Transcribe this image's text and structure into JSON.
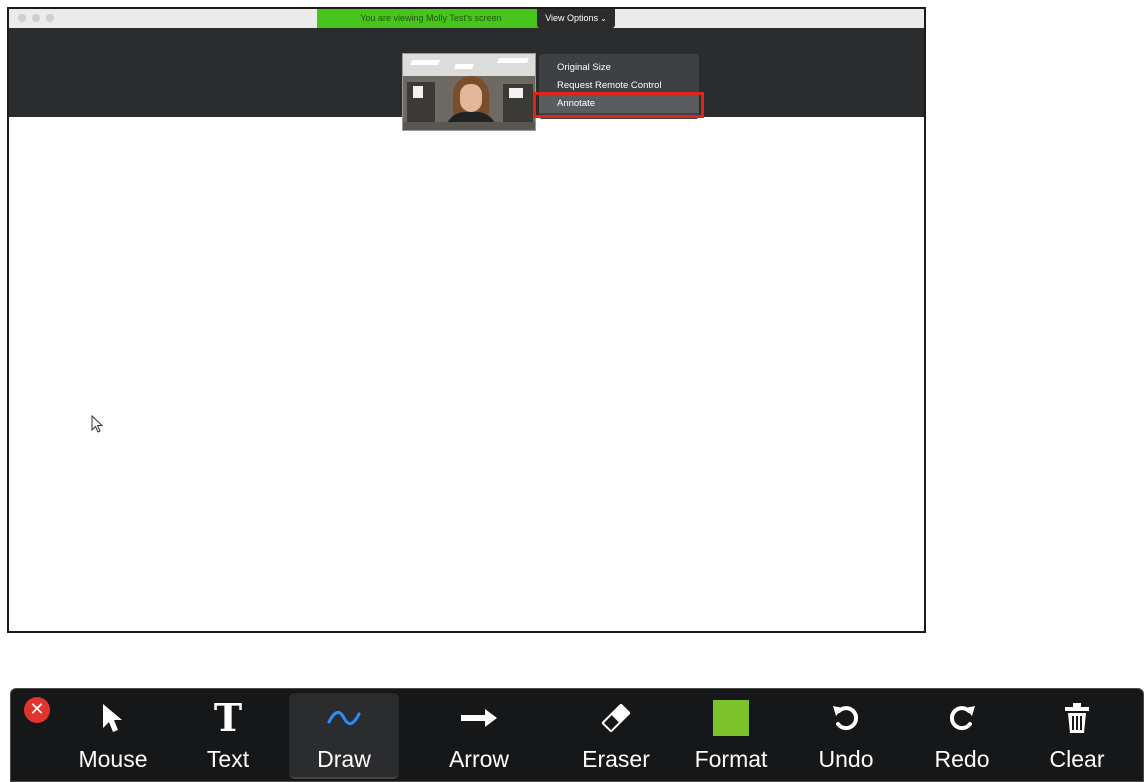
{
  "window": {
    "banner_text": "You are viewing Molly Test's screen",
    "view_options_label": "View Options",
    "menu": {
      "items": [
        "Original Size",
        "Request Remote Control",
        "Annotate"
      ],
      "highlighted_index": 2
    }
  },
  "toolbar": {
    "tools": [
      {
        "label": "Mouse",
        "icon": "cursor-arrow-icon"
      },
      {
        "label": "Text",
        "icon": "text-icon"
      },
      {
        "label": "Draw",
        "icon": "squiggle-icon"
      },
      {
        "label": "Arrow",
        "icon": "right-arrow-icon"
      },
      {
        "label": "Eraser",
        "icon": "eraser-icon"
      },
      {
        "label": "Format",
        "icon": "color-swatch-icon"
      },
      {
        "label": "Undo",
        "icon": "undo-icon"
      },
      {
        "label": "Redo",
        "icon": "redo-icon"
      },
      {
        "label": "Clear",
        "icon": "trash-icon"
      }
    ],
    "active_tool": "Draw",
    "format_color": "#7cc22a",
    "draw_icon_color": "#2d8cff",
    "close_color": "#e0342f"
  },
  "colors": {
    "banner_green": "#47c51d",
    "highlight_red": "#e02417"
  }
}
